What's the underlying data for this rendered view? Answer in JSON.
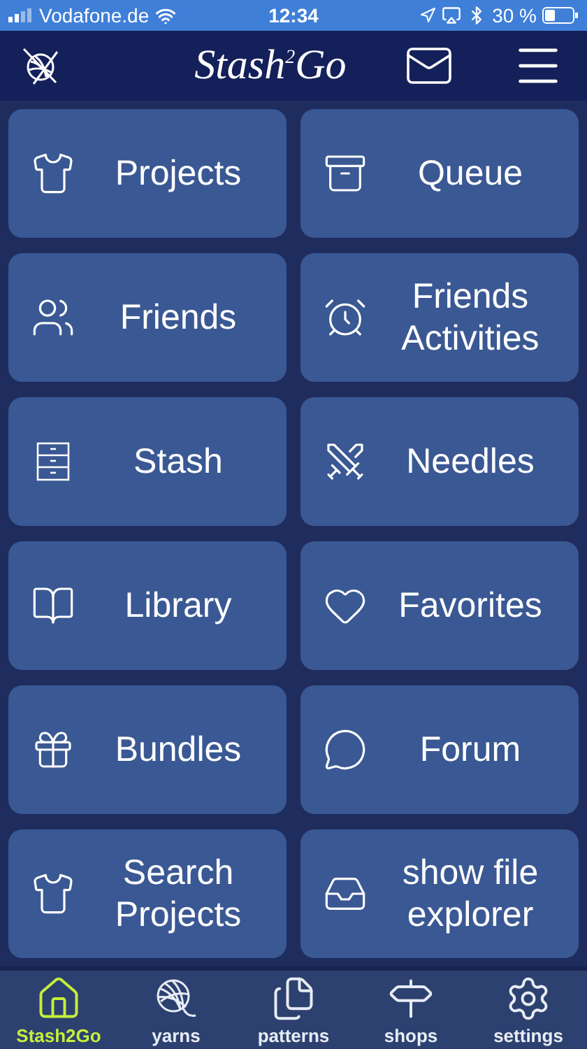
{
  "status_bar": {
    "carrier": "Vodafone.de",
    "time": "12:34",
    "battery": "30 %"
  },
  "header": {
    "logo": "Stash$^{2}$Go"
  },
  "tiles": [
    {
      "label": "Projects"
    },
    {
      "label": "Queue"
    },
    {
      "label": "Friends"
    },
    {
      "label": "Friends Activities"
    },
    {
      "label": "Stash"
    },
    {
      "label": "Needles"
    },
    {
      "label": "Library"
    },
    {
      "label": "Favorites"
    },
    {
      "label": "Bundles"
    },
    {
      "label": "Forum"
    },
    {
      "label": "Search Projects"
    },
    {
      "label": "show file explorer"
    }
  ],
  "tab_bar": [
    {
      "label": "Stash2Go",
      "selected": true
    },
    {
      "label": "yarns",
      "selected": false
    },
    {
      "label": "patterns",
      "selected": false
    },
    {
      "label": "shops",
      "selected": false
    },
    {
      "label": "settings",
      "selected": false
    }
  ]
}
